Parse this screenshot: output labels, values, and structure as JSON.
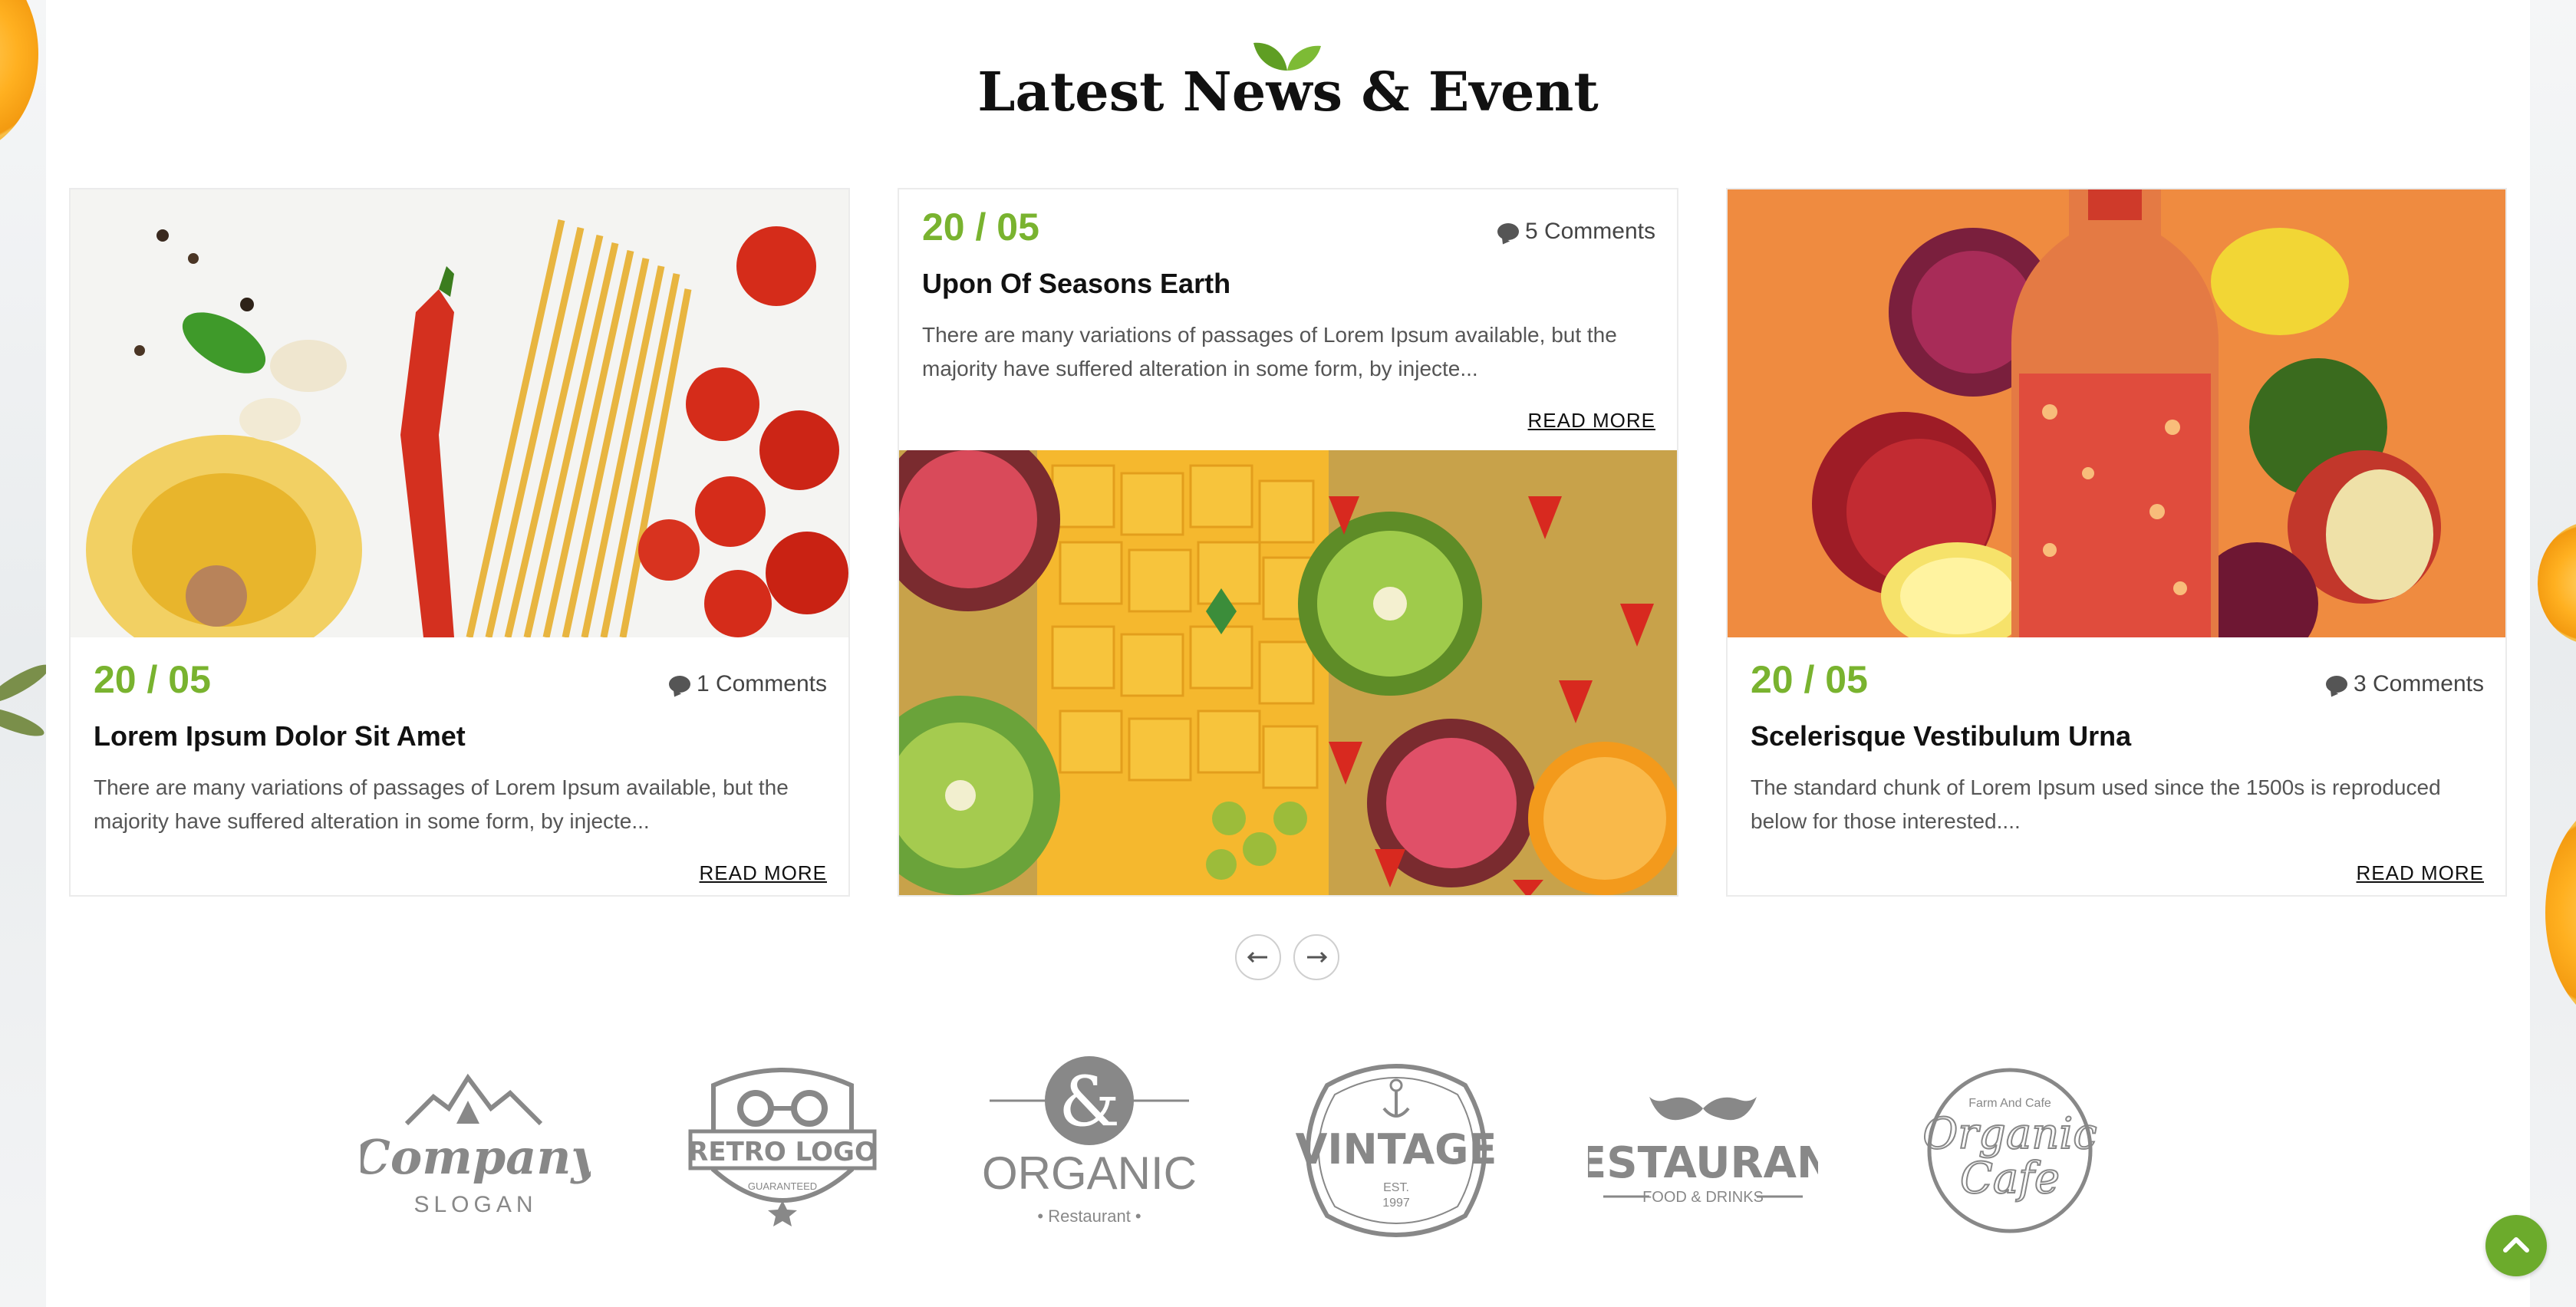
{
  "section": {
    "title": "Latest News & Event"
  },
  "posts": [
    {
      "date": "20 / 05",
      "comments": "1 Comments",
      "title": "Lorem Ipsum Dolor Sit Amet",
      "excerpt": "There are many variations of passages of Lorem Ipsum available, but the majority have suffered alteration in some form, by injecte...",
      "read_more": "READ MORE"
    },
    {
      "date": "20 / 05",
      "comments": "5 Comments",
      "title": "Upon Of Seasons Earth",
      "excerpt": "There are many variations of passages of Lorem Ipsum available, but the majority have suffered alteration in some form, by injecte...",
      "read_more": "READ MORE"
    },
    {
      "date": "20 / 05",
      "comments": "3 Comments",
      "title": "Scelerisque Vestibulum Urna",
      "excerpt": "The standard chunk of Lorem Ipsum used since the 1500s is reproduced below for those interested....",
      "read_more": "READ MORE"
    }
  ],
  "carousel": {
    "prev_icon": "arrow-left-icon",
    "next_icon": "arrow-right-icon"
  },
  "brands": {
    "company": {
      "name": "Company",
      "slogan": "SLOGAN"
    },
    "retro": {
      "name": "RETRO LOGO",
      "tag": "GUARANTEED"
    },
    "organic": {
      "symbol": "&",
      "name": "ORGANIC",
      "sub": "• Restaurant •"
    },
    "vintage": {
      "name": "VINTAGE",
      "est": "EST.",
      "year": "1997"
    },
    "restaurant": {
      "name": "RESTAURANT",
      "sub": "FOOD & DRINKS"
    },
    "cafe": {
      "top": "Farm And Cafe",
      "line1": "Organic",
      "line2": "Cafe"
    }
  },
  "colors": {
    "accent": "#79b32f",
    "scroll_top": "#6cab2c"
  }
}
